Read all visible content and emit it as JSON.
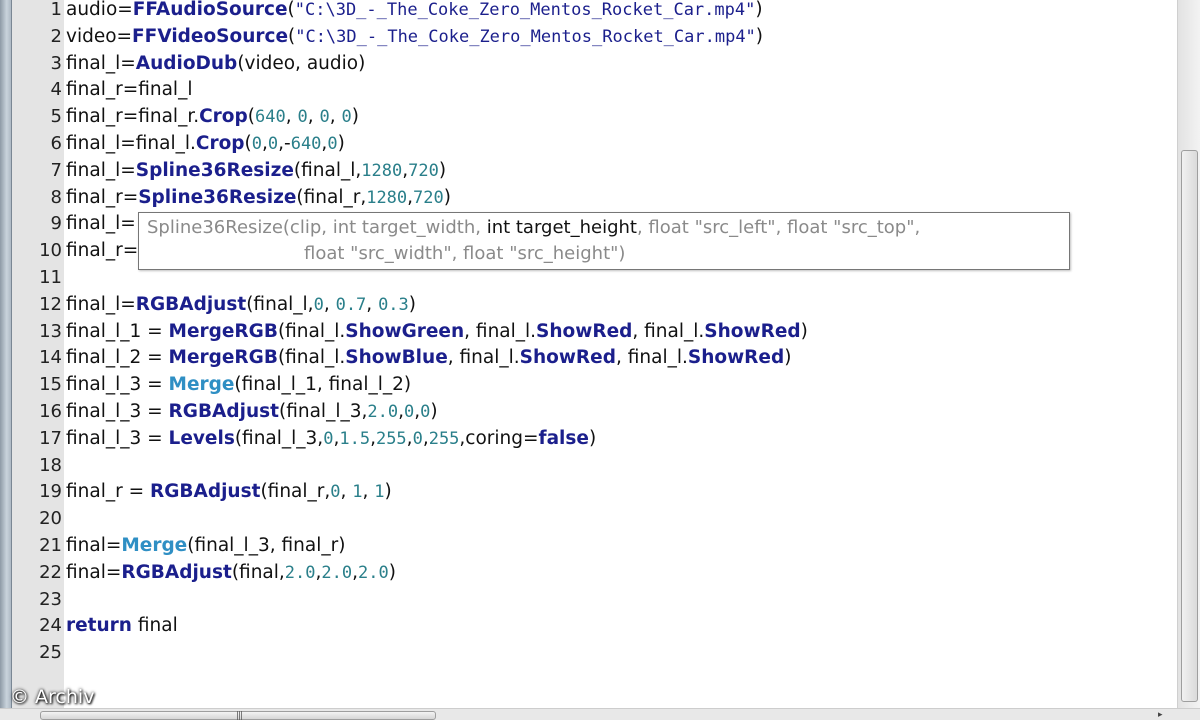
{
  "editor": {
    "lines": [
      {
        "n": "1",
        "parts": [
          [
            "t",
            "audio="
          ],
          [
            "kw",
            "FFAudioSource"
          ],
          [
            "t",
            "("
          ],
          [
            "str",
            "\"C:\\3D_-_The_Coke_Zero_Mentos_Rocket_Car.mp4\""
          ],
          [
            "t",
            ")"
          ]
        ]
      },
      {
        "n": "2",
        "parts": [
          [
            "t",
            "video="
          ],
          [
            "kw",
            "FFVideoSource"
          ],
          [
            "t",
            "("
          ],
          [
            "str",
            "\"C:\\3D_-_The_Coke_Zero_Mentos_Rocket_Car.mp4\""
          ],
          [
            "t",
            ")"
          ]
        ]
      },
      {
        "n": "3",
        "parts": [
          [
            "t",
            "final_l="
          ],
          [
            "kw",
            "AudioDub"
          ],
          [
            "t",
            "(video, audio)"
          ]
        ]
      },
      {
        "n": "4",
        "parts": [
          [
            "t",
            "final_r=final_l"
          ]
        ]
      },
      {
        "n": "5",
        "parts": [
          [
            "t",
            "final_r=final_r."
          ],
          [
            "kw",
            "Crop"
          ],
          [
            "t",
            "("
          ],
          [
            "num",
            "640"
          ],
          [
            "t",
            ", "
          ],
          [
            "num",
            "0"
          ],
          [
            "t",
            ", "
          ],
          [
            "num",
            "0"
          ],
          [
            "t",
            ", "
          ],
          [
            "num",
            "0"
          ],
          [
            "t",
            ")"
          ]
        ]
      },
      {
        "n": "6",
        "parts": [
          [
            "t",
            "final_l=final_l."
          ],
          [
            "kw",
            "Crop"
          ],
          [
            "t",
            "("
          ],
          [
            "num",
            "0"
          ],
          [
            "t",
            ","
          ],
          [
            "num",
            "0"
          ],
          [
            "t",
            ",-"
          ],
          [
            "num",
            "640"
          ],
          [
            "t",
            ","
          ],
          [
            "num",
            "0"
          ],
          [
            "t",
            ")"
          ]
        ]
      },
      {
        "n": "7",
        "parts": [
          [
            "t",
            "final_l="
          ],
          [
            "kw",
            "Spline36Resize"
          ],
          [
            "t",
            "(final_l,"
          ],
          [
            "num",
            "1280"
          ],
          [
            "t",
            ","
          ],
          [
            "num",
            "720"
          ],
          [
            "t",
            ")"
          ]
        ]
      },
      {
        "n": "8",
        "parts": [
          [
            "t",
            "final_r="
          ],
          [
            "kw",
            "Spline36Resize"
          ],
          [
            "t",
            "(final_r,"
          ],
          [
            "num",
            "1280"
          ],
          [
            "t",
            ","
          ],
          [
            "num",
            "720"
          ],
          [
            "t",
            ")"
          ]
        ]
      },
      {
        "n": "9",
        "parts": [
          [
            "t",
            "final_l="
          ]
        ]
      },
      {
        "n": "10",
        "parts": [
          [
            "t",
            "final_r="
          ]
        ]
      },
      {
        "n": "11",
        "parts": []
      },
      {
        "n": "12",
        "parts": [
          [
            "t",
            "final_l="
          ],
          [
            "kw",
            "RGBAdjust"
          ],
          [
            "t",
            "(final_l,"
          ],
          [
            "num",
            "0"
          ],
          [
            "t",
            ", "
          ],
          [
            "num",
            "0.7"
          ],
          [
            "t",
            ", "
          ],
          [
            "num",
            "0.3"
          ],
          [
            "t",
            ")"
          ]
        ]
      },
      {
        "n": "13",
        "parts": [
          [
            "t",
            "final_l_1 = "
          ],
          [
            "kw",
            "MergeRGB"
          ],
          [
            "t",
            "(final_l."
          ],
          [
            "kw",
            "ShowGreen"
          ],
          [
            "t",
            ", final_l."
          ],
          [
            "kw",
            "ShowRed"
          ],
          [
            "t",
            ", final_l."
          ],
          [
            "kw",
            "ShowRed"
          ],
          [
            "t",
            ")"
          ]
        ]
      },
      {
        "n": "14",
        "parts": [
          [
            "t",
            "final_l_2 = "
          ],
          [
            "kw",
            "MergeRGB"
          ],
          [
            "t",
            "(final_l."
          ],
          [
            "kw",
            "ShowBlue"
          ],
          [
            "t",
            ", final_l."
          ],
          [
            "kw",
            "ShowRed"
          ],
          [
            "t",
            ", final_l."
          ],
          [
            "kw",
            "ShowRed"
          ],
          [
            "t",
            ")"
          ]
        ]
      },
      {
        "n": "15",
        "parts": [
          [
            "t",
            "final_l_3 = "
          ],
          [
            "kwb",
            "Merge"
          ],
          [
            "t",
            "(final_l_1, final_l_2)"
          ]
        ]
      },
      {
        "n": "16",
        "parts": [
          [
            "t",
            "final_l_3 = "
          ],
          [
            "kw",
            "RGBAdjust"
          ],
          [
            "t",
            "(final_l_3,"
          ],
          [
            "num",
            "2.0"
          ],
          [
            "t",
            ","
          ],
          [
            "num",
            "0"
          ],
          [
            "t",
            ","
          ],
          [
            "num",
            "0"
          ],
          [
            "t",
            ")"
          ]
        ]
      },
      {
        "n": "17",
        "parts": [
          [
            "t",
            "final_l_3 = "
          ],
          [
            "kw",
            "Levels"
          ],
          [
            "t",
            "(final_l_3,"
          ],
          [
            "num",
            "0"
          ],
          [
            "t",
            ","
          ],
          [
            "num",
            "1.5"
          ],
          [
            "t",
            ","
          ],
          [
            "num",
            "255"
          ],
          [
            "t",
            ","
          ],
          [
            "num",
            "0"
          ],
          [
            "t",
            ","
          ],
          [
            "num",
            "255"
          ],
          [
            "t",
            ",coring="
          ],
          [
            "bool",
            "false"
          ],
          [
            "t",
            ")"
          ]
        ]
      },
      {
        "n": "18",
        "parts": []
      },
      {
        "n": "19",
        "parts": [
          [
            "t",
            "final_r = "
          ],
          [
            "kw",
            "RGBAdjust"
          ],
          [
            "t",
            "(final_r,"
          ],
          [
            "num",
            "0"
          ],
          [
            "t",
            ", "
          ],
          [
            "num",
            "1"
          ],
          [
            "t",
            ", "
          ],
          [
            "num",
            "1"
          ],
          [
            "t",
            ")"
          ]
        ]
      },
      {
        "n": "20",
        "parts": []
      },
      {
        "n": "21",
        "parts": [
          [
            "t",
            "final="
          ],
          [
            "kwb",
            "Merge"
          ],
          [
            "t",
            "(final_l_3, final_r)"
          ]
        ]
      },
      {
        "n": "22",
        "parts": [
          [
            "t",
            "final="
          ],
          [
            "kw",
            "RGBAdjust"
          ],
          [
            "t",
            "(final,"
          ],
          [
            "num",
            "2.0"
          ],
          [
            "t",
            ","
          ],
          [
            "num",
            "2.0"
          ],
          [
            "t",
            ","
          ],
          [
            "num",
            "2.0"
          ],
          [
            "t",
            ")"
          ]
        ]
      },
      {
        "n": "23",
        "parts": []
      },
      {
        "n": "24",
        "parts": [
          [
            "kw",
            "return"
          ],
          [
            "t",
            " final"
          ]
        ]
      },
      {
        "n": "25",
        "parts": []
      }
    ]
  },
  "tooltip": {
    "line1_before": "Spline36Resize(clip, int target_width, ",
    "line1_current": "int target_height",
    "line1_after": ", float \"src_left\", float \"src_top\",",
    "line2": "float \"src_width\", float \"src_height\")"
  },
  "watermark": "© Archiv",
  "colors": {
    "keyword": "#1b1f8c",
    "keyword_light": "#2f8fc4",
    "number": "#2a7f8a",
    "gutter": "#e4e4e4"
  }
}
